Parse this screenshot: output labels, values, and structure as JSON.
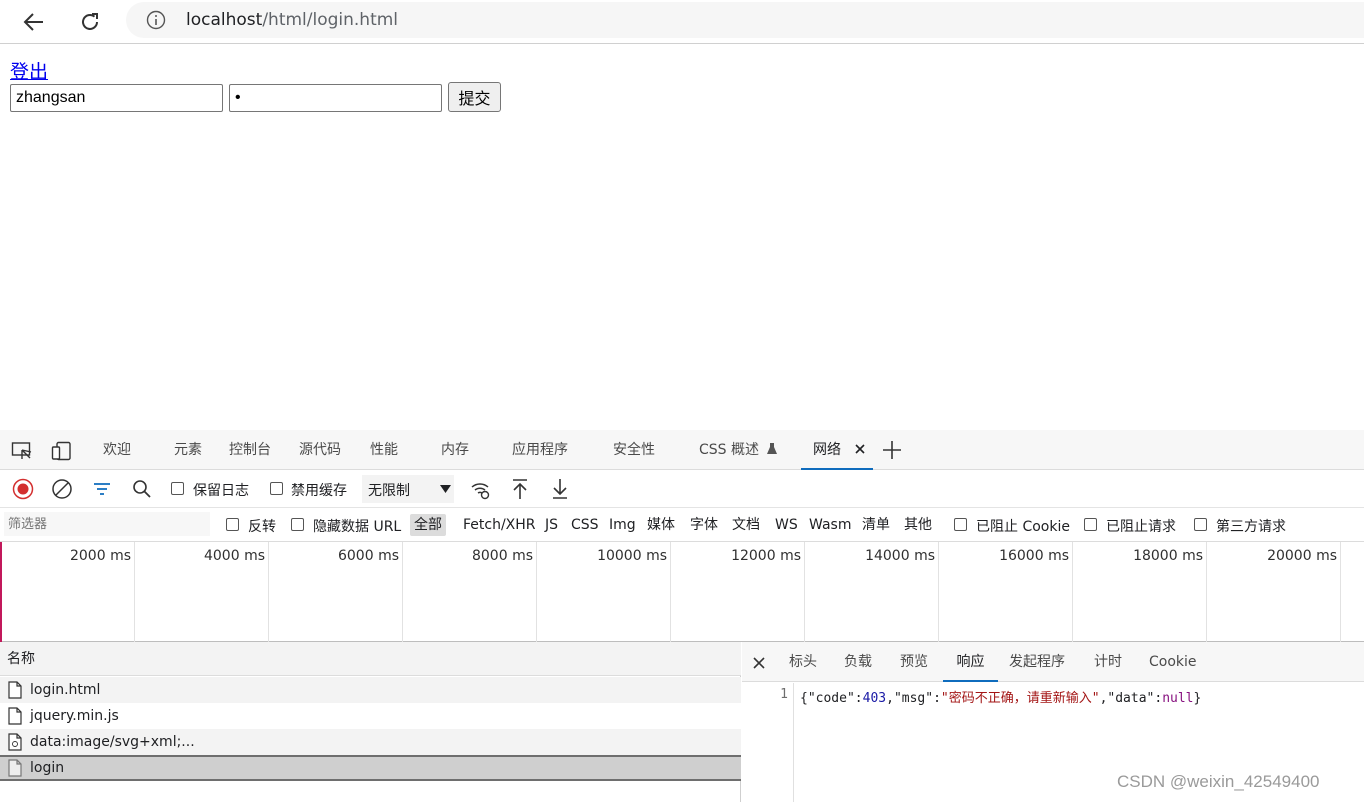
{
  "browser": {
    "url_host": "localhost",
    "url_path": "/html/login.html"
  },
  "page": {
    "logout_link": "登出",
    "username_value": "zhangsan",
    "password_value": "•",
    "submit_label": "提交"
  },
  "devtools": {
    "tabs": [
      "欢迎",
      "元素",
      "控制台",
      "源代码",
      "性能",
      "内存",
      "应用程序",
      "安全性",
      "CSS 概述",
      "网络"
    ],
    "active_tab": "网络",
    "toolbar": {
      "preserve_log": "保留日志",
      "disable_cache": "禁用缓存",
      "throttling": "无限制"
    },
    "filter": {
      "placeholder": "筛选器",
      "invert": "反转",
      "hide_data_urls": "隐藏数据 URL",
      "types": [
        "全部",
        "Fetch/XHR",
        "JS",
        "CSS",
        "Img",
        "媒体",
        "字体",
        "文档",
        "WS",
        "Wasm",
        "清单",
        "其他"
      ],
      "blocked_cookies": "已阻止 Cookie",
      "blocked_requests": "已阻止请求",
      "third_party": "第三方请求"
    },
    "timeline_ticks": [
      "2000 ms",
      "4000 ms",
      "6000 ms",
      "8000 ms",
      "10000 ms",
      "12000 ms",
      "14000 ms",
      "16000 ms",
      "18000 ms",
      "20000 ms"
    ],
    "request_list": {
      "header": "名称",
      "rows": [
        "login.html",
        "jquery.min.js",
        "data:image/svg+xml;...",
        "login"
      ],
      "selected": "login"
    },
    "detail": {
      "tabs": [
        "标头",
        "负载",
        "预览",
        "响应",
        "发起程序",
        "计时",
        "Cookie"
      ],
      "active_tab": "响应",
      "line_number": "1",
      "response": {
        "k1": "\"code\"",
        "v1": "403",
        "k2": "\"msg\"",
        "v2": "\"密码不正确，请重新输入\"",
        "k3": "\"data\"",
        "v3": "null"
      }
    }
  },
  "watermark": "CSDN @weixin_42549400"
}
